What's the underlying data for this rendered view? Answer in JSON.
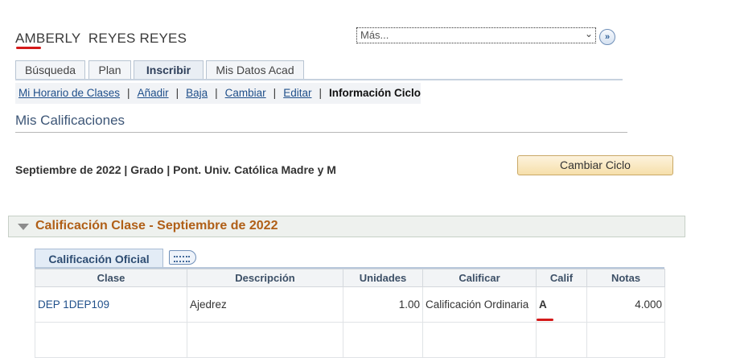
{
  "student": {
    "name": "AMBERLY  REYES REYES"
  },
  "nav_select": {
    "value": "Más..."
  },
  "tabs": [
    {
      "label": "Búsqueda"
    },
    {
      "label": "Plan"
    },
    {
      "label": "Inscribir"
    },
    {
      "label": "Mis Datos Acad"
    }
  ],
  "subnav": {
    "items": [
      {
        "label": "Mi Horario de Clases"
      },
      {
        "label": "Añadir"
      },
      {
        "label": "Baja"
      },
      {
        "label": "Cambiar"
      },
      {
        "label": "Editar"
      }
    ],
    "current": "Información Ciclo",
    "separator": "|"
  },
  "page": {
    "title": "Mis Calificaciones"
  },
  "term": {
    "info": "Septiembre de 2022 | Grado | Pont. Univ. Católica Madre y M"
  },
  "change_term_button": "Cambiar Ciclo",
  "section": {
    "title": "Calificación Clase - Septiembre de 2022"
  },
  "grid": {
    "tab_label": "Calificación Oficial",
    "columns": [
      "Clase",
      "Descripción",
      "Unidades",
      "Calificar",
      "Calif",
      "Notas"
    ],
    "rows": [
      {
        "clase": "DEP 1DEP109",
        "descripcion": "Ajedrez",
        "unidades": "1.00",
        "calificar": "Calificación Ordinaria",
        "calif": "A",
        "notas": "4.000"
      }
    ]
  },
  "colors": {
    "accent_link": "#1f4f8a",
    "section_title": "#b05f17",
    "annotation_red": "#d41a1a",
    "button_fill": "#f6dfaa"
  }
}
